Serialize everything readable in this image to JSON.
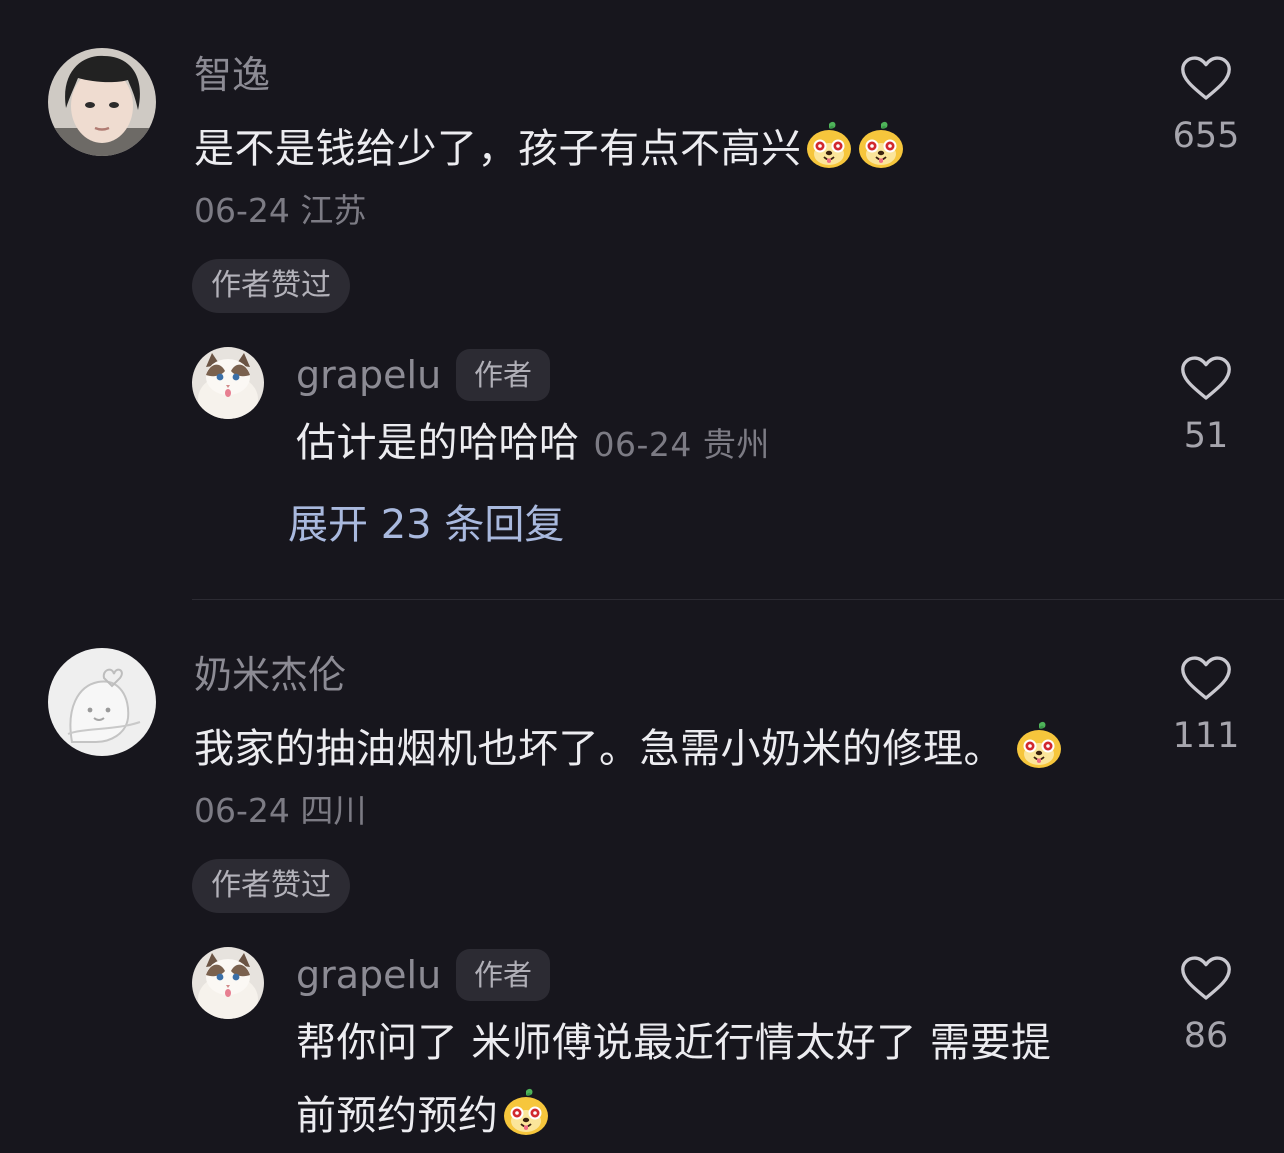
{
  "comments": [
    {
      "username": "智逸",
      "text": "是不是钱给少了，孩子有点不高兴",
      "emoji_count": 2,
      "date": "06-24",
      "location": "江苏",
      "author_liked_label": "作者赞过",
      "like_count": "655",
      "reply": {
        "username": "grapelu",
        "author_tag": "作者",
        "text": "估计是的哈哈哈",
        "date": "06-24",
        "location": "贵州",
        "like_count": "51"
      },
      "expand_label": "展开 23 条回复"
    },
    {
      "username": "奶米杰伦",
      "text": "我家的抽油烟机也坏了。急需小奶米的修理。",
      "emoji_count": 1,
      "date": "06-24",
      "location": "四川",
      "author_liked_label": "作者赞过",
      "like_count": "111",
      "reply": {
        "username": "grapelu",
        "author_tag": "作者",
        "text_line1": "帮你问了 米师傅说最近行情太好了 需要提",
        "text_line2": "前预约预约",
        "like_count": "86"
      }
    }
  ],
  "colors": {
    "background": "#17161d",
    "link": "#a9b9de",
    "chip": "#2c2b33"
  },
  "icons": {
    "like": "heart-outline-icon",
    "emoji": "smiling-dog-emoji-icon"
  }
}
